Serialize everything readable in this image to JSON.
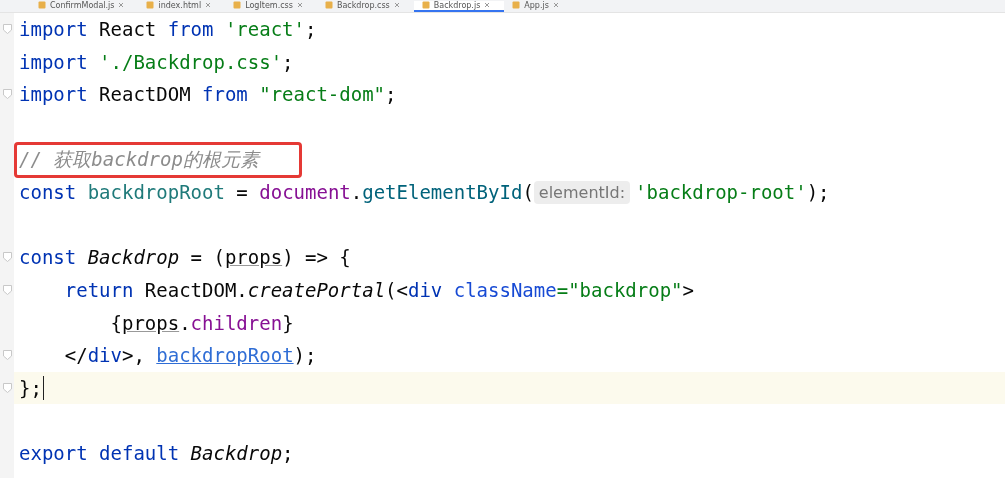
{
  "tabs": [
    {
      "label": "ConfirmModal.js",
      "selected": false
    },
    {
      "label": "index.html",
      "selected": false
    },
    {
      "label": "LogItem.css",
      "selected": false
    },
    {
      "label": "Backdrop.css",
      "selected": false
    },
    {
      "label": "Backdrop.js",
      "selected": true
    },
    {
      "label": "App.js",
      "selected": false
    }
  ],
  "editor": {
    "lines": [
      {
        "fold": true,
        "current": false,
        "boxed": false,
        "tokens": [
          {
            "kind": "keyword",
            "text": "import "
          },
          {
            "kind": "plain",
            "text": "React "
          },
          {
            "kind": "keyword",
            "text": "from "
          },
          {
            "kind": "string",
            "text": "'react'"
          },
          {
            "kind": "plain",
            "text": ";"
          }
        ]
      },
      {
        "fold": false,
        "current": false,
        "boxed": false,
        "tokens": [
          {
            "kind": "keyword",
            "text": "import "
          },
          {
            "kind": "string",
            "text": "'./Backdrop.css'"
          },
          {
            "kind": "plain",
            "text": ";"
          }
        ]
      },
      {
        "fold": true,
        "current": false,
        "boxed": false,
        "tokens": [
          {
            "kind": "keyword",
            "text": "import "
          },
          {
            "kind": "plain",
            "text": "ReactDOM "
          },
          {
            "kind": "keyword",
            "text": "from "
          },
          {
            "kind": "string",
            "text": "\"react-dom\""
          },
          {
            "kind": "plain",
            "text": ";"
          }
        ]
      },
      {
        "fold": false,
        "current": false
      },
      {
        "fold": false,
        "current": false,
        "boxed": true,
        "tokens": [
          {
            "kind": "comment",
            "text": "// 获取backdrop的根元素"
          }
        ]
      },
      {
        "fold": false,
        "current": false,
        "boxed": false,
        "tokens": [
          {
            "kind": "keyword",
            "text": "const "
          },
          {
            "kind": "variable",
            "text": "backdropRoot"
          },
          {
            "kind": "plain",
            "text": " = "
          },
          {
            "kind": "global",
            "text": "document"
          },
          {
            "kind": "plain",
            "text": "."
          },
          {
            "kind": "function",
            "text": "getElementById"
          },
          {
            "kind": "plain",
            "text": "("
          },
          {
            "kind": "hint",
            "text": "elementId:"
          },
          {
            "kind": "string",
            "text": "'backdrop-root'"
          },
          {
            "kind": "plain",
            "text": ");"
          }
        ]
      },
      {
        "fold": false,
        "current": false
      },
      {
        "fold": true,
        "current": false,
        "boxed": false,
        "tokens": [
          {
            "kind": "keyword",
            "text": "const "
          },
          {
            "kind": "italic",
            "text": "Backdrop"
          },
          {
            "kind": "plain",
            "text": " = ("
          },
          {
            "kind": "param",
            "text": "props"
          },
          {
            "kind": "plain",
            "text": ") => {"
          }
        ]
      },
      {
        "fold": true,
        "current": false,
        "boxed": false,
        "tokens": [
          {
            "kind": "keyword",
            "text": "    return "
          },
          {
            "kind": "plain",
            "text": "ReactDOM."
          },
          {
            "kind": "italic",
            "text": "createPortal"
          },
          {
            "kind": "plain",
            "text": "(<"
          },
          {
            "kind": "keyword",
            "text": "div "
          },
          {
            "kind": "attr",
            "text": "className"
          },
          {
            "kind": "string",
            "text": "=\"backdrop\""
          },
          {
            "kind": "plain",
            "text": ">"
          }
        ]
      },
      {
        "fold": false,
        "current": false,
        "boxed": false,
        "tokens": [
          {
            "kind": "plain",
            "text": "        {"
          },
          {
            "kind": "param",
            "text": "props"
          },
          {
            "kind": "plain",
            "text": "."
          },
          {
            "kind": "global",
            "text": "children"
          },
          {
            "kind": "plain",
            "text": "}"
          }
        ]
      },
      {
        "fold": true,
        "current": false,
        "boxed": false,
        "tokens": [
          {
            "kind": "plain",
            "text": "    </"
          },
          {
            "kind": "keyword",
            "text": "div"
          },
          {
            "kind": "plain",
            "text": ">, "
          },
          {
            "kind": "link",
            "text": "backdropRoot"
          },
          {
            "kind": "plain",
            "text": ");"
          }
        ]
      },
      {
        "fold": true,
        "current": true,
        "boxed": false,
        "tokens": [
          {
            "kind": "plain",
            "text": "};"
          }
        ]
      },
      {
        "fold": false,
        "current": false
      },
      {
        "fold": false,
        "current": false,
        "boxed": false,
        "tokens": [
          {
            "kind": "keyword",
            "text": "export default "
          },
          {
            "kind": "italic",
            "text": "Backdrop"
          },
          {
            "kind": "plain",
            "text": ";"
          }
        ]
      }
    ]
  }
}
